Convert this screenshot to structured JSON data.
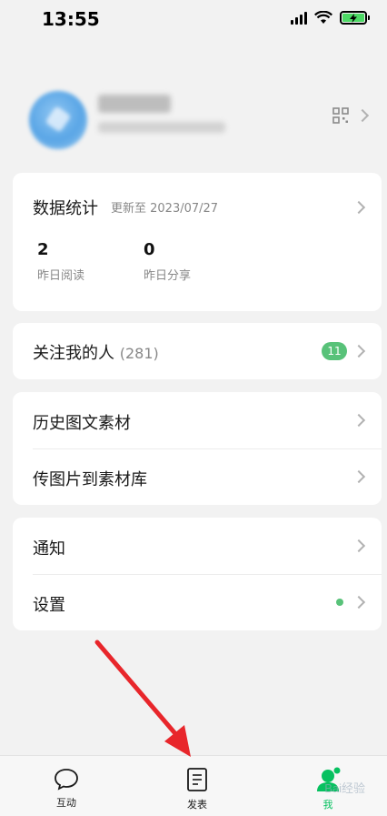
{
  "status_bar": {
    "time": "13:55"
  },
  "stats": {
    "title": "数据统计",
    "updated": "更新至 2023/07/27",
    "items": [
      {
        "value": "2",
        "label": "昨日阅读"
      },
      {
        "value": "0",
        "label": "昨日分享"
      }
    ]
  },
  "followers": {
    "label": "关注我的人",
    "count": "(281)",
    "badge": "11"
  },
  "materials": [
    {
      "label": "历史图文素材"
    },
    {
      "label": "传图片到素材库"
    }
  ],
  "settings": [
    {
      "label": "通知"
    },
    {
      "label": "设置"
    }
  ],
  "tabs": [
    {
      "label": "互动",
      "icon": "chat-bubble-icon"
    },
    {
      "label": "发表",
      "icon": "document-icon"
    },
    {
      "label": "我",
      "icon": "person-icon",
      "active": true
    }
  ],
  "colors": {
    "accent": "#07c160",
    "badge": "#58c279",
    "arrow": "#e8262b"
  },
  "watermark": "Bai经验"
}
